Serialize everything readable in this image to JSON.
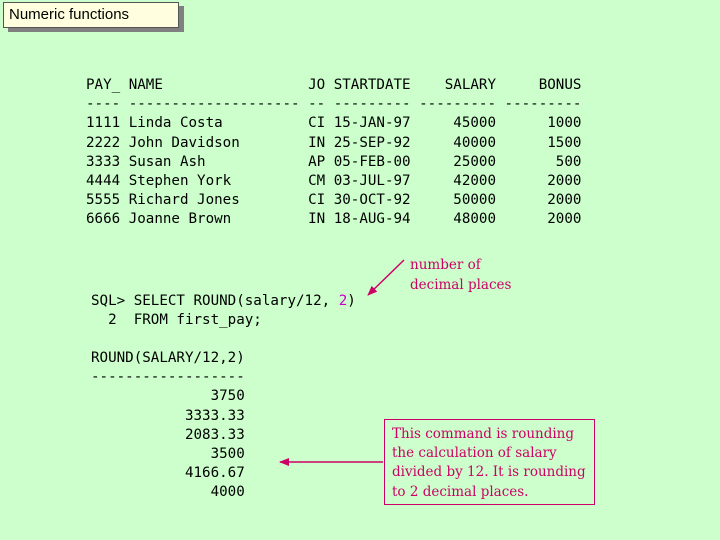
{
  "slide": {
    "title": "Numeric functions"
  },
  "table": {
    "columns": [
      "PAY_",
      "NAME",
      "JO",
      "STARTDATE",
      "SALARY",
      "BONUS"
    ],
    "separator": "---- -------------------- -- --------- --------- ---------",
    "rows": [
      {
        "pay": "1111",
        "name": "Linda Costa",
        "jo": "CI",
        "startdate": "15-JAN-97",
        "salary": "45000",
        "bonus": "1000"
      },
      {
        "pay": "2222",
        "name": "John Davidson",
        "jo": "IN",
        "startdate": "25-SEP-92",
        "salary": "40000",
        "bonus": "1500"
      },
      {
        "pay": "3333",
        "name": "Susan Ash",
        "jo": "AP",
        "startdate": "05-FEB-00",
        "salary": "25000",
        "bonus": "500"
      },
      {
        "pay": "4444",
        "name": "Stephen York",
        "jo": "CM",
        "startdate": "03-JUL-97",
        "salary": "42000",
        "bonus": "2000"
      },
      {
        "pay": "5555",
        "name": "Richard Jones",
        "jo": "CI",
        "startdate": "30-OCT-92",
        "salary": "50000",
        "bonus": "2000"
      },
      {
        "pay": "6666",
        "name": "Joanne Brown",
        "jo": "IN",
        "startdate": "18-AUG-94",
        "salary": "48000",
        "bonus": "2000"
      }
    ]
  },
  "sql": {
    "line1_prefix": "SQL> SELECT ROUND(salary/12, ",
    "line1_highlight": "2",
    "line1_suffix": ")",
    "line2": "  2  FROM first_pay;"
  },
  "result": {
    "header": "ROUND(SALARY/12,2)",
    "separator": "------------------",
    "values": [
      "3750",
      "3333.33",
      "2083.33",
      "3500",
      "4166.67",
      "4000"
    ]
  },
  "annotations": {
    "top_note": "number of decimal places",
    "box_note": "This command is rounding the calculation of salary divided by 12.  It is rounding to 2 decimal places."
  },
  "colors": {
    "background": "#ccffcc",
    "title_box": "#ffffe0",
    "annotation": "#cc0066",
    "highlight": "#cc00cc"
  }
}
